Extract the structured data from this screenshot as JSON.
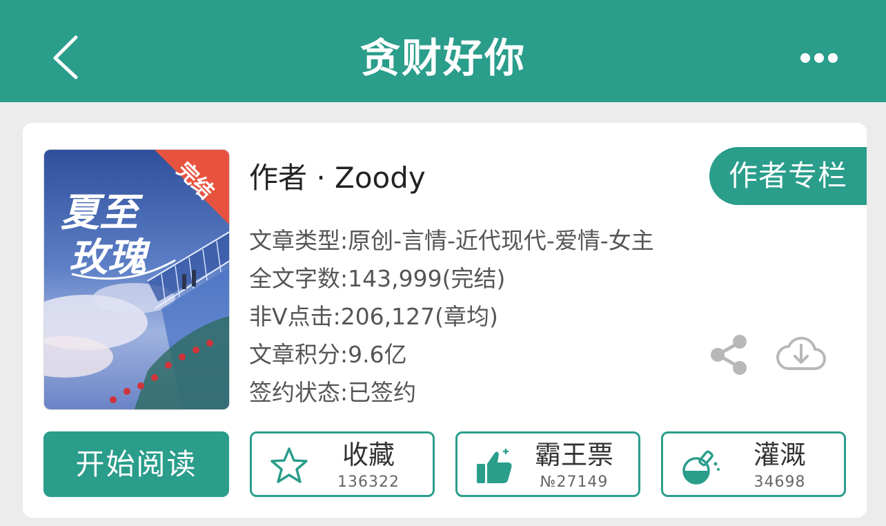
{
  "header": {
    "title": "贪财好你"
  },
  "book": {
    "cover_badge": "完结",
    "cover_title_line1": "夏至",
    "cover_title_line2": "玫瑰",
    "author_line": "作者 · Zoody",
    "author_column_label": "作者专栏",
    "info": [
      "文章类型:原创-言情-近代现代-爱情-女主",
      "全文字数:143,999(完结)",
      "非V点击:206,127(章均)",
      "文章积分:9.6亿",
      "签约状态:已签约"
    ]
  },
  "actions": {
    "start_label": "开始阅读",
    "favorite": {
      "label": "收藏",
      "count": "136322"
    },
    "vote": {
      "label": "霸王票",
      "count": "№27149"
    },
    "nourish": {
      "label": "灌溉",
      "count": "34698"
    }
  },
  "colors": {
    "accent": "#2a9d8b",
    "background": "#ececec",
    "card": "#ffffff",
    "icon_gray": "#b8b8b8"
  },
  "icons": {
    "back": "chevron-left-icon",
    "more": "more-dots-icon",
    "share": "share-icon",
    "download": "cloud-download-icon",
    "favorite": "star-icon",
    "vote": "thumbs-up-icon",
    "nourish": "flask-icon"
  }
}
